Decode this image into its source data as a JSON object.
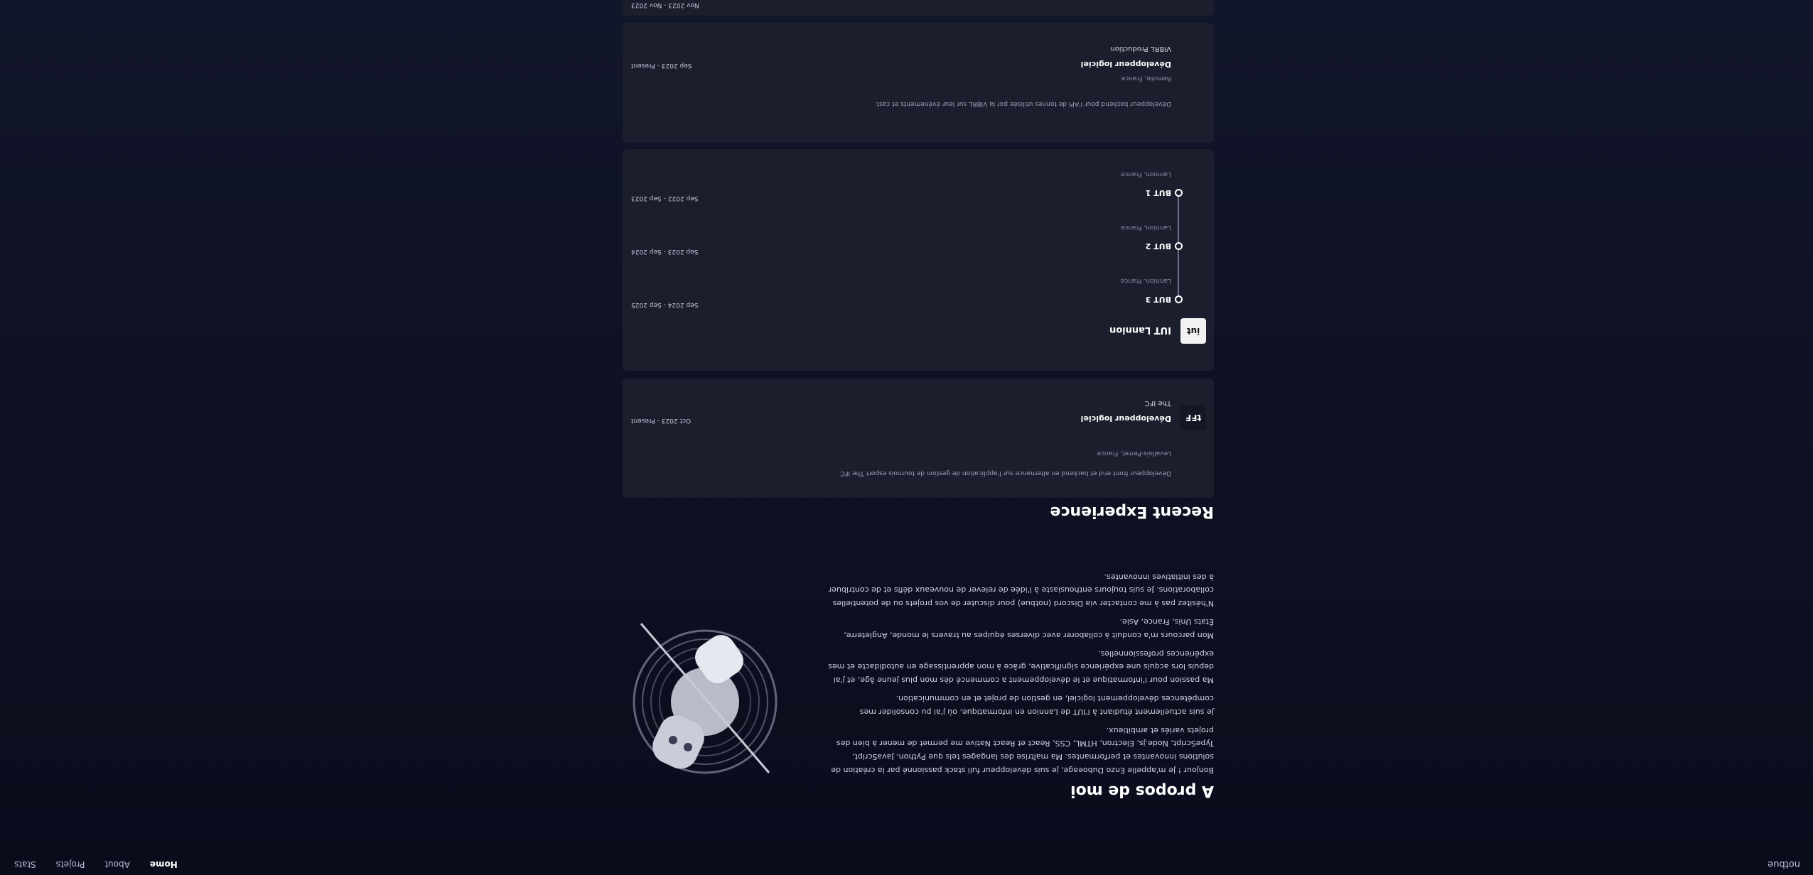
{
  "nav": {
    "brand": "notbue",
    "links": [
      "Home",
      "About",
      "Projets",
      "Stats"
    ],
    "active": "Home"
  },
  "about": {
    "title": "A propos de moi",
    "paragraphs": [
      "Bonjour ! Je m'appelle Enzo Duboeage, je suis développeur full stack passionné par la création de solutions innovantes et performantes. Ma maîtrise des langages tels que Python, JavaScript, TypeScript, Node.js, Electron, HTML, CSS, React et React Native me permet de mener à bien des projets variés et ambitieux.",
      "Je suis actuellement étudiant à l'IUT de Lannion en informatique, où j'ai pu consolider mes compétences développement logiciel, en gestion de projet et en communication.",
      "Ma passion pour l'informatique et le développement a commencé dès mon plus jeune âge, et j'ai depuis lors acquis une expérience significative, grâce à mon apprentissage en autodidacte et mes expériences professionnelles.",
      "Mon parcours m'a conduit à collaborer avec diverses équipes au travers le monde, Angleterre, États Unis, France, Asie.",
      "N'hésitez pas à me contacter via Discord (notbue) pour discuter de vos projets ou de potentielles collaborations. Je suis toujours enthousiaste à l'idée de relever de nouveaux défis et de contribuer à des initiatives innovantes."
    ],
    "image_icon": "astronaut-illustration"
  },
  "experience": {
    "title": "Recent Experience",
    "items": [
      {
        "logo_text": "tFF",
        "title": "Développeur logiciel",
        "company": "The IFC",
        "location": "Levallois-Perret, France",
        "description": "Développeur front end et backend en alternance sur l'application de gestion de tournois esport The IFC.",
        "dates": "Oct 2023 - Present"
      },
      {
        "logo_text": "iut",
        "company": "IUT Lannion",
        "steps": [
          {
            "title": "BUT 3",
            "location": "Lannion, France",
            "dates": "Sep 2024 - Sep 2025"
          },
          {
            "title": "BUT 2",
            "location": "Lannion, France",
            "dates": "Sep 2023 - Sep 2024"
          },
          {
            "title": "BUT 1",
            "location": "Lannion, France",
            "dates": "Sep 2022 - Sep 2023"
          }
        ]
      },
      {
        "title": "Développeur logiciel",
        "company": "VIBRL Production",
        "location": "Remote, France",
        "description": "Développeur backend pour l'API de tonnes utilisée par la VIBRL sur leur événements et cast.",
        "dates": "Sep 2023 - Present"
      },
      {
        "dates": "Nov 2023 - Nov 2023"
      }
    ]
  }
}
